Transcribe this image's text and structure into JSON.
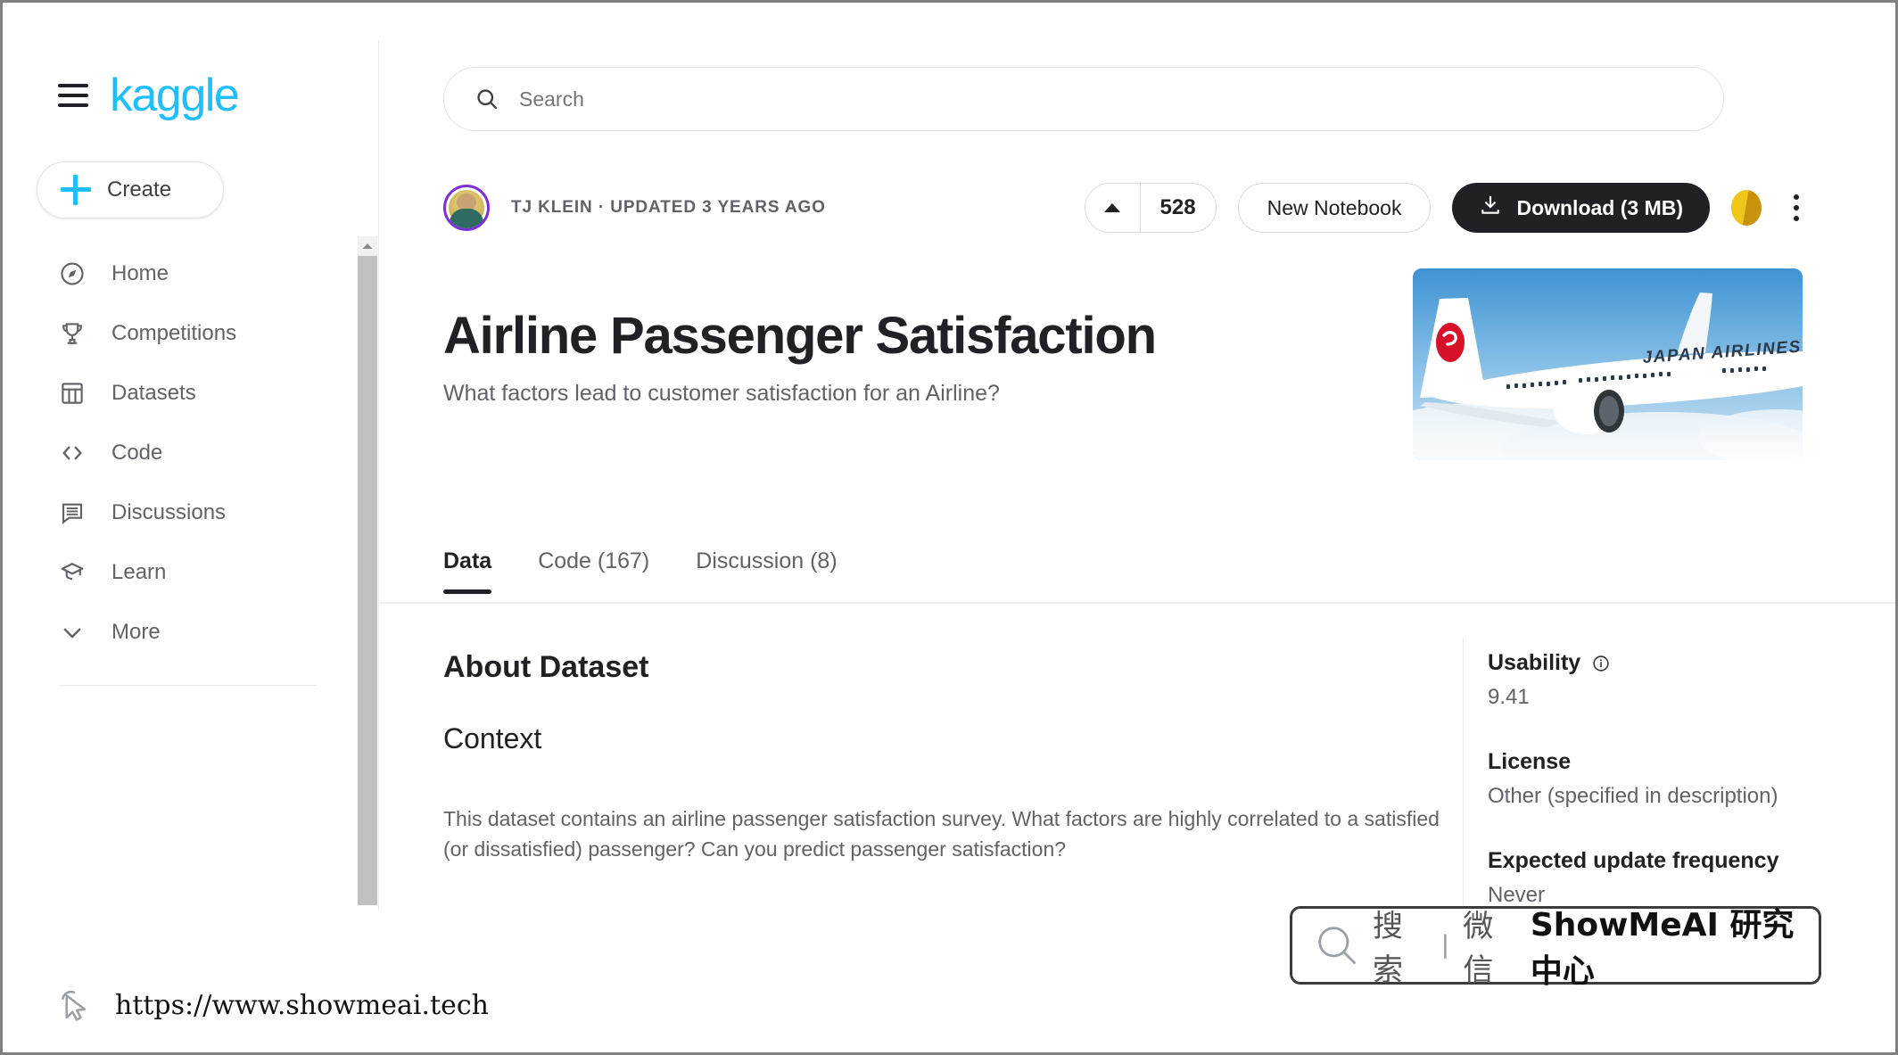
{
  "brand": {
    "logo_text": "kaggle",
    "menu_icon": "hamburger-menu-icon"
  },
  "sidebar": {
    "create_label": "Create",
    "items": [
      {
        "label": "Home",
        "icon": "compass-icon"
      },
      {
        "label": "Competitions",
        "icon": "trophy-icon"
      },
      {
        "label": "Datasets",
        "icon": "table-icon"
      },
      {
        "label": "Code",
        "icon": "code-brackets-icon"
      },
      {
        "label": "Discussions",
        "icon": "comment-icon"
      },
      {
        "label": "Learn",
        "icon": "graduation-cap-icon"
      },
      {
        "label": "More",
        "icon": "chevron-down-icon"
      }
    ]
  },
  "search": {
    "placeholder": "Search",
    "value": "",
    "icon": "search-icon"
  },
  "dataset": {
    "author": "TJ KLEIN",
    "meta_line": "TJ KLEIN · UPDATED 3 YEARS AGO",
    "title": "Airline Passenger Satisfaction",
    "subtitle": "What factors lead to customer satisfaction for an Airline?",
    "hero_alt": "japan-airlines-aircraft-photo",
    "hero_text": "JAPAN AIRLINES"
  },
  "actions": {
    "vote_count": "528",
    "vote_icon": "caret-up-icon",
    "new_notebook_label": "New Notebook",
    "download_label": "Download (3 MB)",
    "download_icon": "download-icon",
    "medal_icon": "gold-medal-icon",
    "more_icon": "kebab-menu-icon"
  },
  "tabs": [
    {
      "label": "Data",
      "active": true
    },
    {
      "label": "Code (167)",
      "active": false
    },
    {
      "label": "Discussion (8)",
      "active": false
    }
  ],
  "content": {
    "about_heading": "About Dataset",
    "context_heading": "Context",
    "context_paragraph": "This dataset contains an airline passenger satisfaction survey. What factors are highly correlated to a satisfied (or dissatisfied) passenger? Can you predict passenger satisfaction?"
  },
  "metadata": [
    {
      "label": "Usability",
      "value": "9.41",
      "has_info_icon": true
    },
    {
      "label": "License",
      "value": "Other (specified in description)",
      "has_info_icon": false
    },
    {
      "label": "Expected update frequency",
      "value": "Never",
      "has_info_icon": false
    }
  ],
  "watermark": {
    "search_icon": "magnifier-icon",
    "cn_search": "搜索",
    "separator": "|",
    "cn_wechat": "微信",
    "brand": "ShowMeAI 研究中心"
  },
  "footer": {
    "url": "https://www.showmeai.tech",
    "cursor_icon": "cursor-pointer-icon"
  },
  "colors": {
    "brand_blue": "#20BEFF",
    "dark": "#202124",
    "muted": "#5f6368",
    "medal_gold": "#f0c419",
    "avatar_ring": "#7b2fd6"
  }
}
